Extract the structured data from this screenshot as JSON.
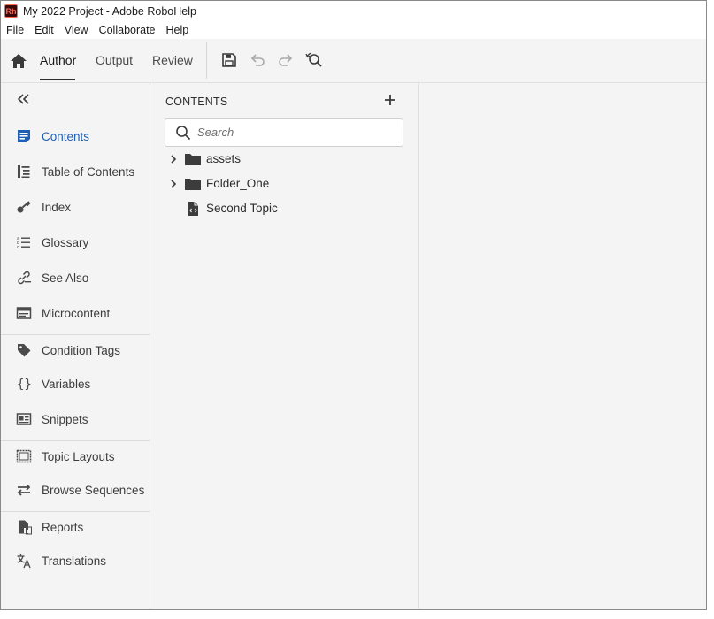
{
  "window": {
    "title": "My 2022 Project - Adobe RoboHelp",
    "logo_text": "Rh"
  },
  "menu": [
    "File",
    "Edit",
    "View",
    "Collaborate",
    "Help"
  ],
  "toolbar": {
    "tabs": [
      {
        "label": "Author",
        "active": true
      },
      {
        "label": "Output",
        "active": false
      },
      {
        "label": "Review",
        "active": false
      }
    ],
    "icons": [
      "home-icon",
      "save-icon",
      "undo-icon",
      "redo-icon",
      "find-replace-icon"
    ]
  },
  "nav": {
    "collapse_icon": "double-chevron-left-icon",
    "groups": [
      [
        {
          "label": "Contents",
          "icon": "contents-icon",
          "active": true
        },
        {
          "label": "Table of Contents",
          "icon": "toc-icon"
        },
        {
          "label": "Index",
          "icon": "key-icon"
        },
        {
          "label": "Glossary",
          "icon": "glossary-icon"
        },
        {
          "label": "See Also",
          "icon": "link-icon"
        },
        {
          "label": "Microcontent",
          "icon": "microcontent-icon"
        }
      ],
      [
        {
          "label": "Condition Tags",
          "icon": "tag-icon"
        },
        {
          "label": "Variables",
          "icon": "braces-icon"
        },
        {
          "label": "Snippets",
          "icon": "snippet-icon"
        }
      ],
      [
        {
          "label": "Topic Layouts",
          "icon": "layout-icon"
        },
        {
          "label": "Browse Sequences",
          "icon": "sequence-icon"
        }
      ],
      [
        {
          "label": "Reports",
          "icon": "reports-icon"
        },
        {
          "label": "Translations",
          "icon": "translate-icon"
        }
      ]
    ]
  },
  "contents": {
    "title": "CONTENTS",
    "search_placeholder": "Search",
    "items": [
      {
        "label": "assets",
        "type": "folder",
        "expandable": true
      },
      {
        "label": "Folder_One",
        "type": "folder",
        "expandable": true
      },
      {
        "label": "Second Topic",
        "type": "topic",
        "expandable": false
      }
    ]
  },
  "colors": {
    "accent": "#1f5fb4",
    "panel_bg": "#f4f4f4",
    "logo_bg": "#3a0a0a",
    "logo_fg": "#ff6a50"
  }
}
